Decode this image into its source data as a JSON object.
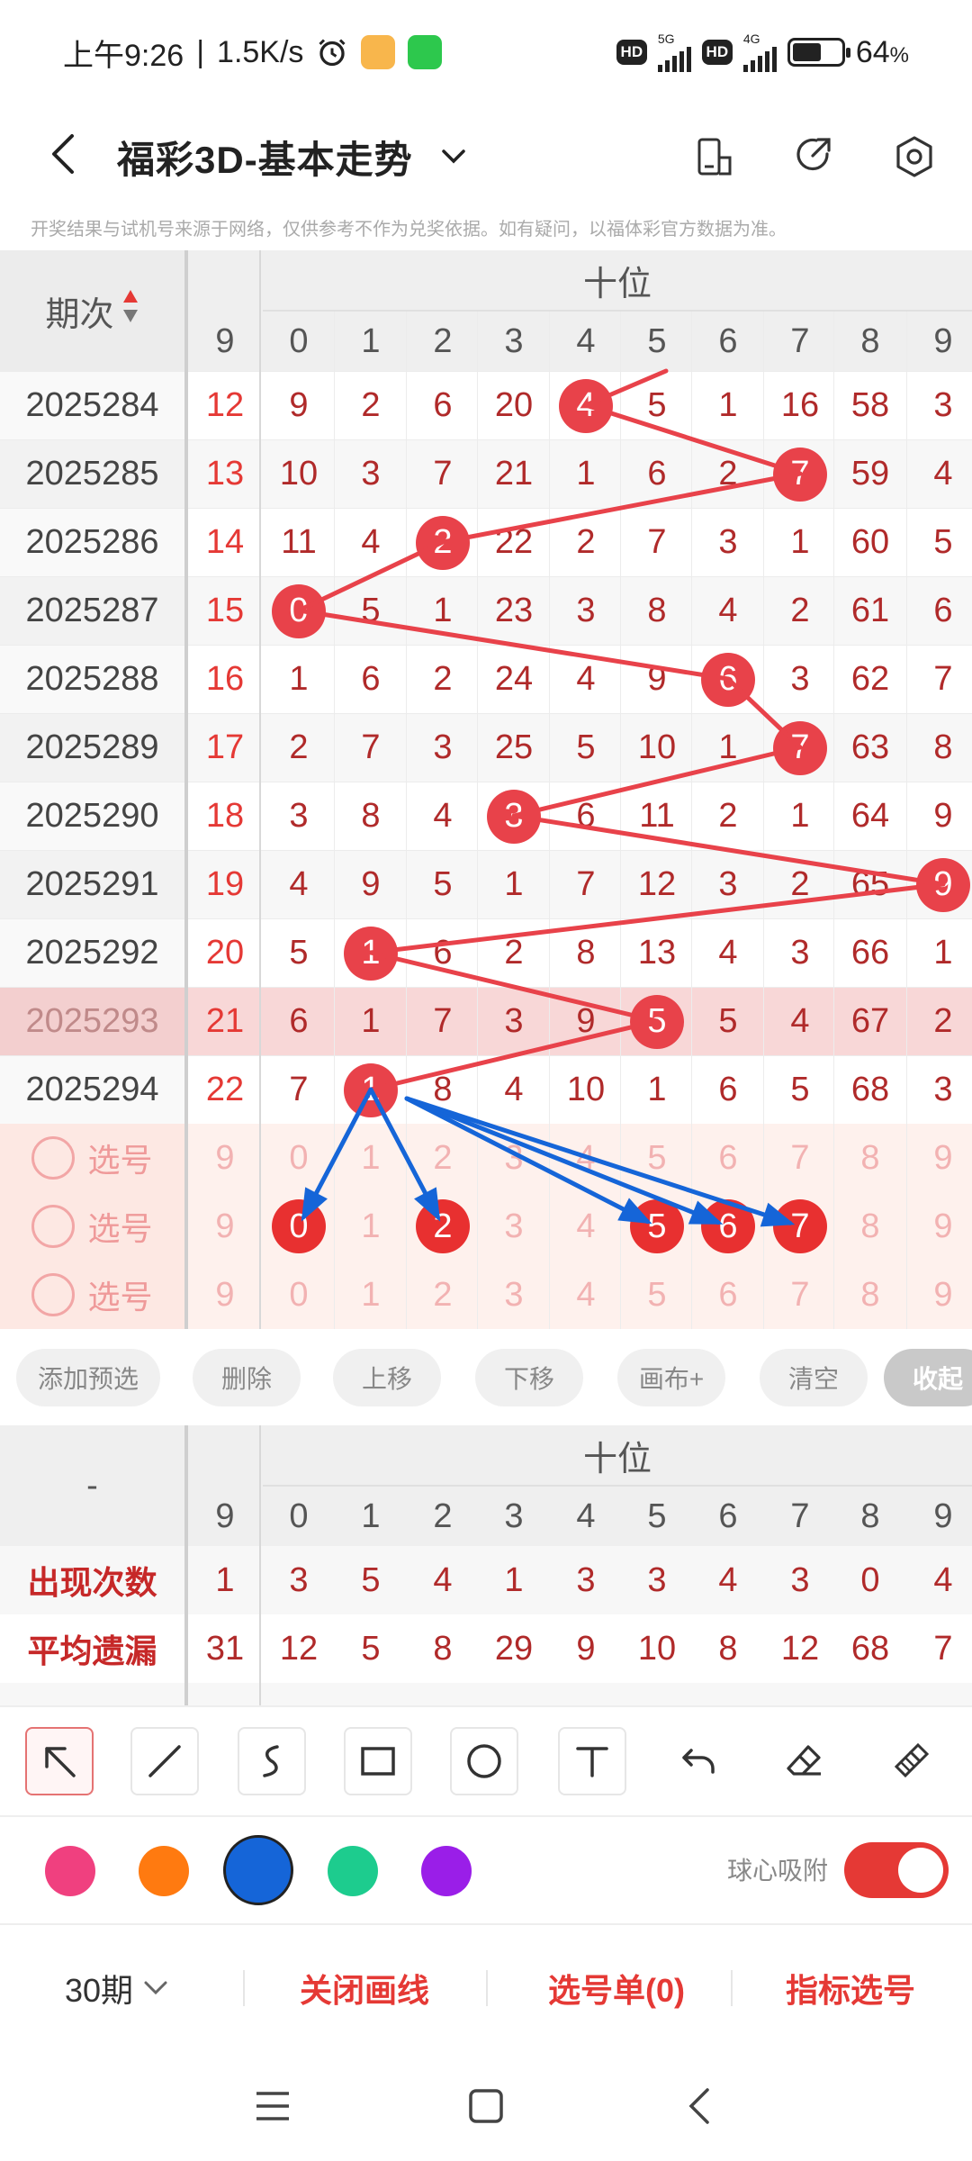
{
  "status": {
    "time": "上午9:26",
    "speed": "1.5K/s",
    "battery": "64",
    "battery_unit": "%",
    "net1": "5G",
    "net2": "4G",
    "hd": "HD"
  },
  "header": {
    "title": "福彩3D-基本走势"
  },
  "disclaimer": "开奖结果与试机号来源于网络，仅供参考不作为兑奖依据。如有疑问，以福体彩官方数据为准。",
  "table": {
    "period_header": "期次",
    "group_header": "十位",
    "columns": [
      "9",
      "0",
      "1",
      "2",
      "3",
      "4",
      "5",
      "6",
      "7",
      "8",
      "9"
    ],
    "rows": [
      {
        "period": "2025284",
        "cells": [
          "12",
          "9",
          "2",
          "6",
          "20",
          "4",
          "5",
          "1",
          "16",
          "58",
          "3"
        ],
        "hit": 5
      },
      {
        "period": "2025285",
        "cells": [
          "13",
          "10",
          "3",
          "7",
          "21",
          "1",
          "6",
          "2",
          "7",
          "59",
          "4"
        ],
        "hit": 8
      },
      {
        "period": "2025286",
        "cells": [
          "14",
          "11",
          "4",
          "2",
          "22",
          "2",
          "7",
          "3",
          "1",
          "60",
          "5"
        ],
        "hit": 3
      },
      {
        "period": "2025287",
        "cells": [
          "15",
          "0",
          "5",
          "1",
          "23",
          "3",
          "8",
          "4",
          "2",
          "61",
          "6"
        ],
        "hit": 1
      },
      {
        "period": "2025288",
        "cells": [
          "16",
          "1",
          "6",
          "2",
          "24",
          "4",
          "9",
          "6",
          "3",
          "62",
          "7"
        ],
        "hit": 7
      },
      {
        "period": "2025289",
        "cells": [
          "17",
          "2",
          "7",
          "3",
          "25",
          "5",
          "10",
          "1",
          "7",
          "63",
          "8"
        ],
        "hit": 8
      },
      {
        "period": "2025290",
        "cells": [
          "18",
          "3",
          "8",
          "4",
          "3",
          "6",
          "11",
          "2",
          "1",
          "64",
          "9"
        ],
        "hit": 4
      },
      {
        "period": "2025291",
        "cells": [
          "19",
          "4",
          "9",
          "5",
          "1",
          "7",
          "12",
          "3",
          "2",
          "65",
          "9"
        ],
        "hit": 10
      },
      {
        "period": "2025292",
        "cells": [
          "20",
          "5",
          "1",
          "6",
          "2",
          "8",
          "13",
          "4",
          "3",
          "66",
          "1"
        ],
        "hit": 2
      },
      {
        "period": "2025293",
        "cells": [
          "21",
          "6",
          "1",
          "7",
          "3",
          "9",
          "5",
          "5",
          "4",
          "67",
          "2"
        ],
        "hit": 6
      },
      {
        "period": "2025294",
        "cells": [
          "22",
          "7",
          "1",
          "8",
          "4",
          "10",
          "1",
          "6",
          "5",
          "68",
          "3"
        ],
        "hit": 2
      }
    ],
    "pick_rows": [
      {
        "label": "选号",
        "cells": [
          "9",
          "0",
          "1",
          "2",
          "3",
          "4",
          "5",
          "6",
          "7",
          "8",
          "9"
        ],
        "picked": []
      },
      {
        "label": "选号",
        "cells": [
          "9",
          "0",
          "1",
          "2",
          "3",
          "4",
          "5",
          "6",
          "7",
          "8",
          "9"
        ],
        "picked": [
          1,
          3,
          6,
          7,
          8
        ]
      },
      {
        "label": "选号",
        "cells": [
          "9",
          "0",
          "1",
          "2",
          "3",
          "4",
          "5",
          "6",
          "7",
          "8",
          "9"
        ],
        "picked": []
      }
    ]
  },
  "actions": [
    "添加预选",
    "删除",
    "上移",
    "下移",
    "画布+",
    "清空",
    "收起"
  ],
  "stats": {
    "left_header": "-",
    "group_header": "十位",
    "columns": [
      "9",
      "0",
      "1",
      "2",
      "3",
      "4",
      "5",
      "6",
      "7",
      "8",
      "9"
    ],
    "rows": [
      {
        "label": "出现次数",
        "cells": [
          "1",
          "3",
          "5",
          "4",
          "1",
          "3",
          "3",
          "4",
          "3",
          "0",
          "4"
        ]
      },
      {
        "label": "平均遗漏",
        "cells": [
          "31",
          "12",
          "5",
          "8",
          "29",
          "9",
          "10",
          "8",
          "12",
          "68",
          "7"
        ]
      }
    ]
  },
  "tools": [
    "arrow-tool",
    "line-tool",
    "curve-tool",
    "rect-tool",
    "circle-tool",
    "text-tool",
    "undo-tool",
    "eraser-tool",
    "clear-tool"
  ],
  "colors": {
    "pink": "#f0407f",
    "orange": "#ff7a10",
    "blue": "#1565d8",
    "green": "#1dcc8e",
    "purple": "#9a1ee8",
    "accent": "#e53935"
  },
  "snap_label": "球心吸附",
  "bottom": {
    "periods": "30期",
    "close_lines": "关闭画线",
    "pick_list": "选号单(0)",
    "indicator": "指标选号"
  }
}
